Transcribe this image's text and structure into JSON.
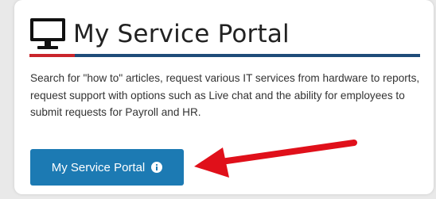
{
  "card": {
    "title": "My Service Portal",
    "title_icon": "monitor-icon",
    "description": "Search for \"how to\" articles, request various IT services from hardware to reports, request support with options such as Live chat and the ability for employees to submit requests for Payroll and HR.",
    "button": {
      "label": "My Service Portal",
      "icon": "info-circle-icon"
    }
  },
  "colors": {
    "accent_red": "#c9252c",
    "accent_blue": "#1f4c79",
    "button_bg": "#1c7ab3",
    "arrow": "#e0101a",
    "page_bg": "#e9e9e9"
  }
}
